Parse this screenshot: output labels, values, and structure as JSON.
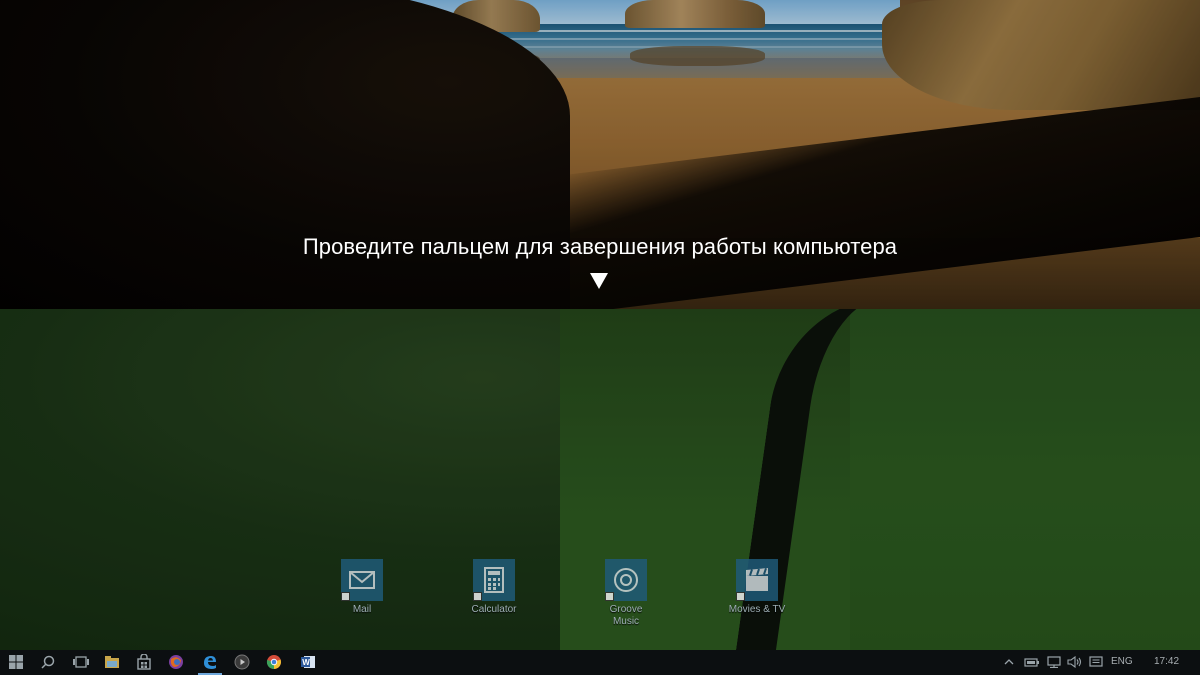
{
  "slide_panel": {
    "message": "Проведите пальцем для завершения работы компьютера",
    "arrow_icon": "triangle-down-icon"
  },
  "desktop": {
    "icons": [
      {
        "label": "Mail",
        "icon": "mail-icon"
      },
      {
        "label": "Calculator",
        "icon": "calculator-icon"
      },
      {
        "label": "Groove Music",
        "icon": "groove-music-icon"
      },
      {
        "label": "Movies & TV",
        "icon": "movies-tv-icon"
      }
    ]
  },
  "taskbar": {
    "buttons": [
      "windows-start-icon",
      "search-icon",
      "task-view-icon",
      "file-explorer-icon",
      "store-icon",
      "firefox-icon",
      "edge-icon",
      "media-player-icon",
      "chrome-icon",
      "word-icon"
    ],
    "tray": {
      "language": "ENG",
      "time": "17:42"
    }
  },
  "colors": {
    "tile_blue": "#1f5a78",
    "taskbar_bg": "#0c0f11",
    "text_white": "#ffffff"
  }
}
